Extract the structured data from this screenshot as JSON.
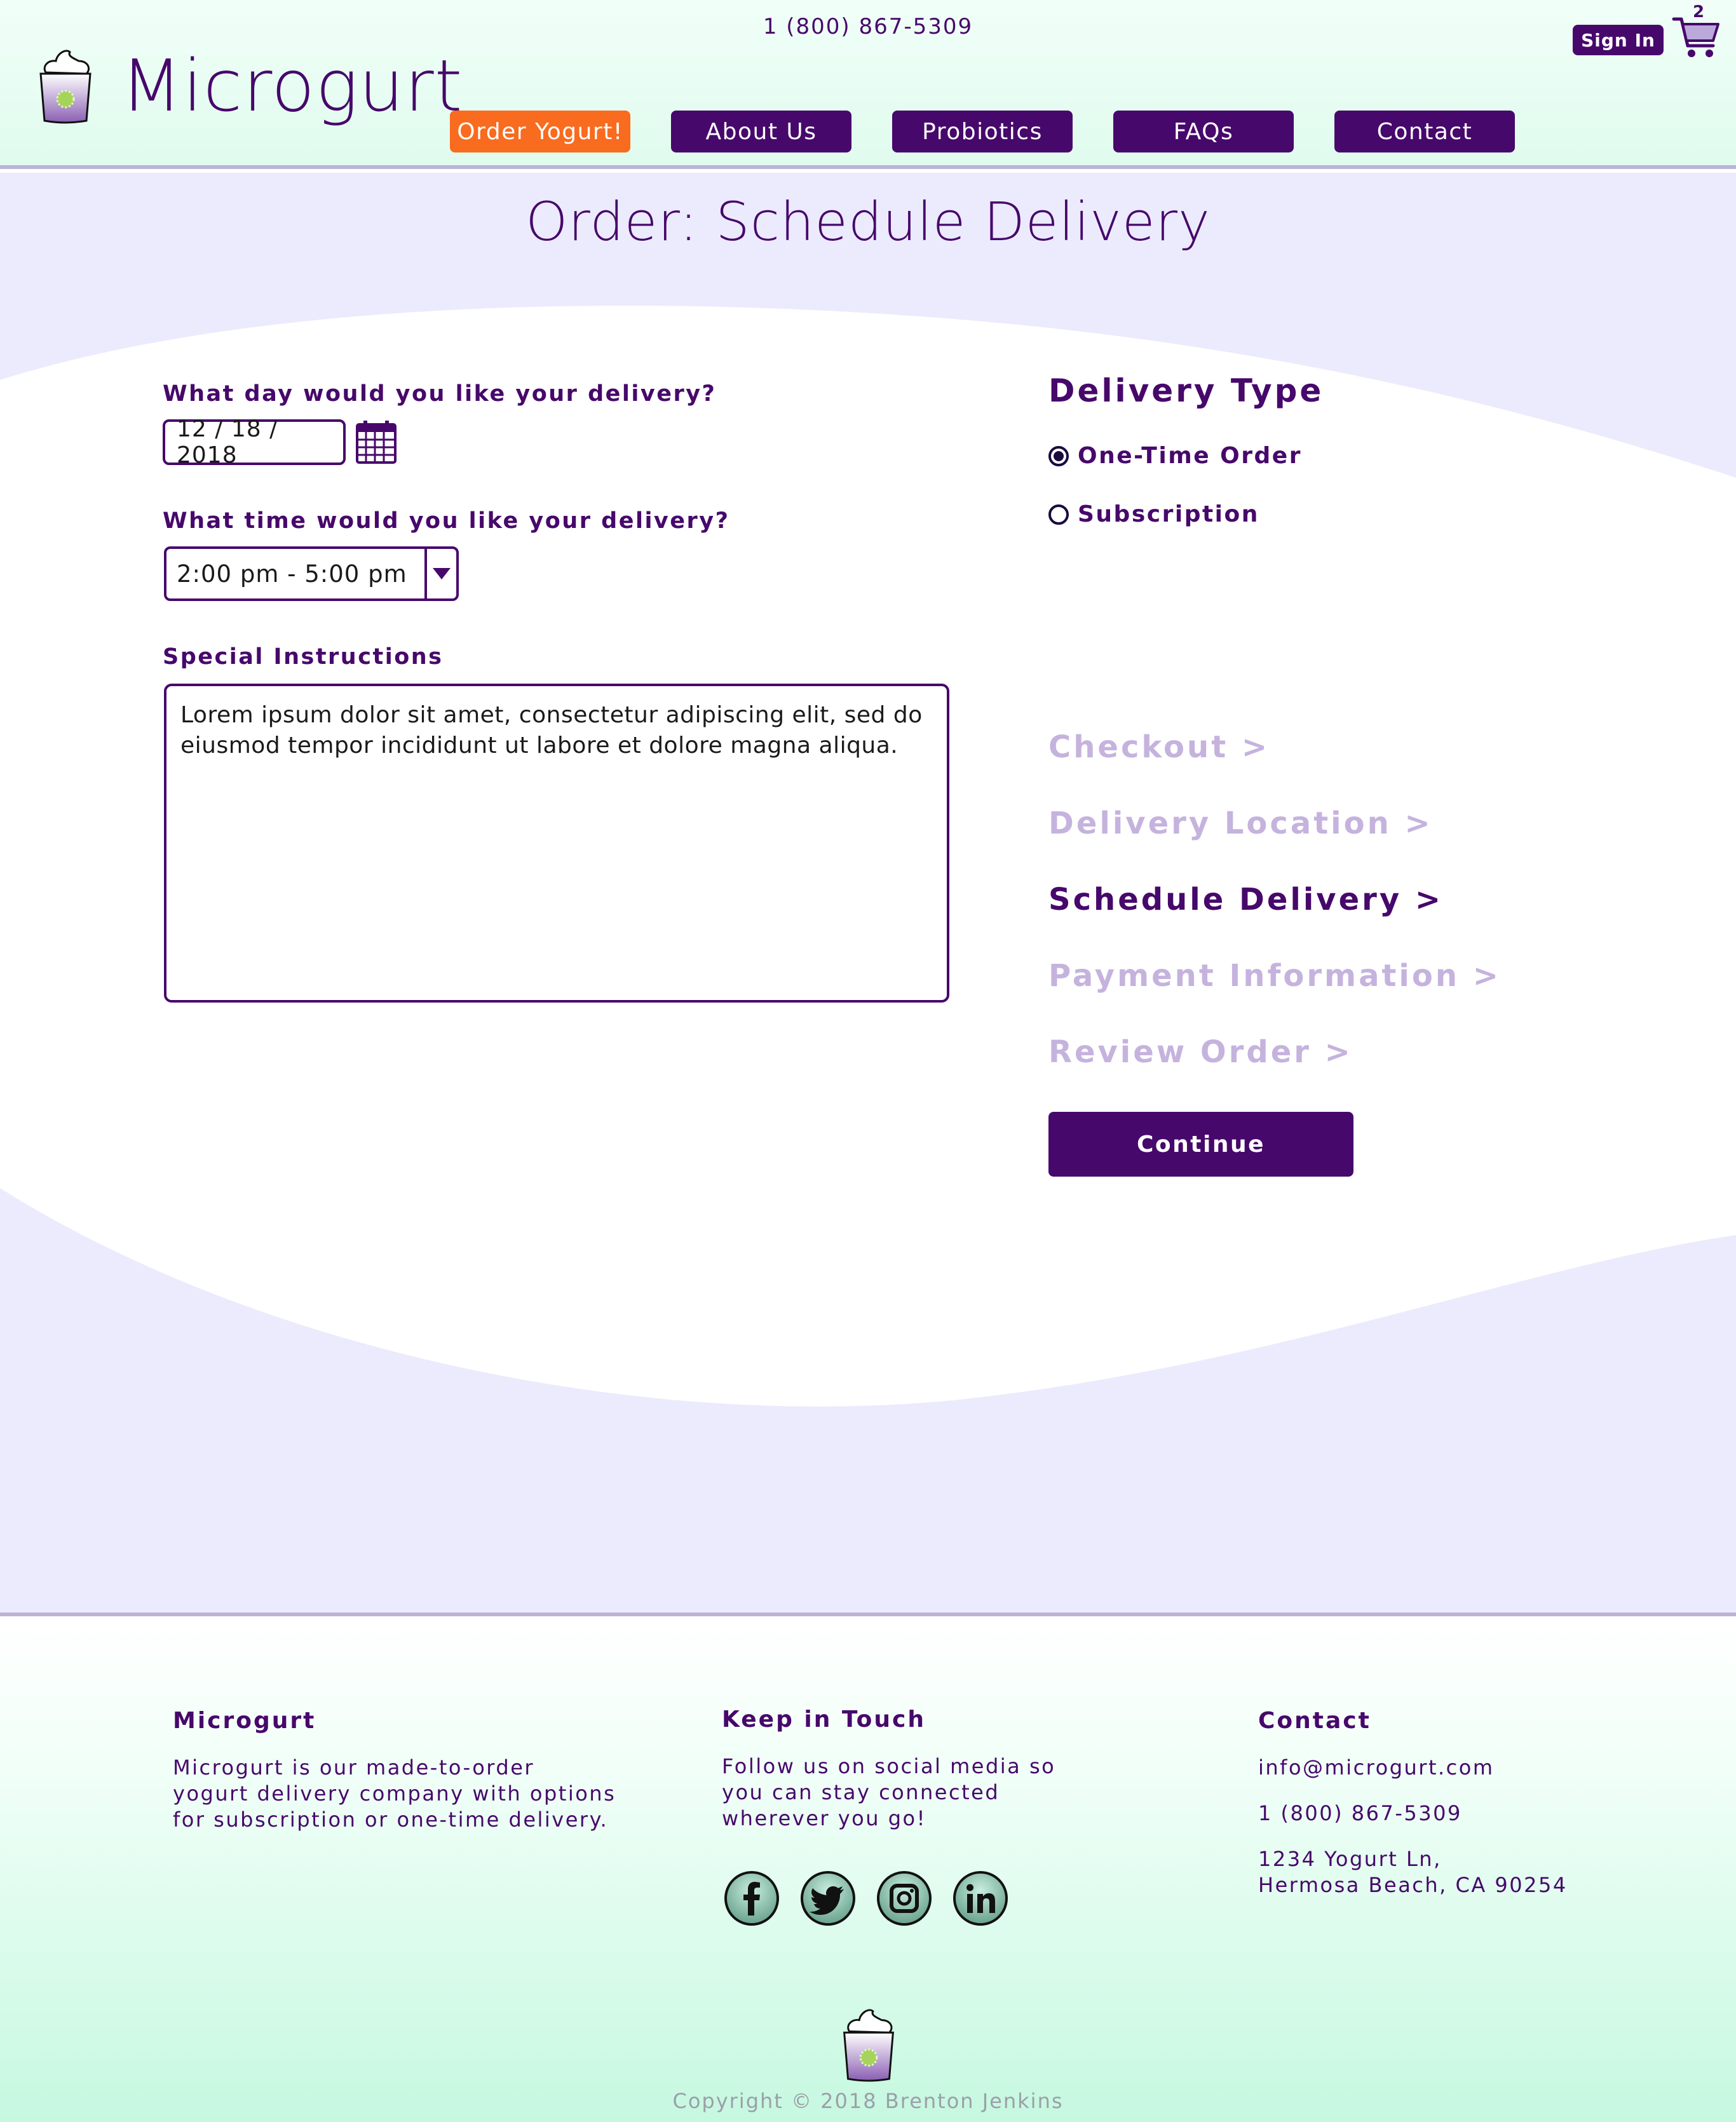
{
  "header": {
    "phone": "1 (800) 867-5309",
    "brand": "Microgurt",
    "nav": [
      {
        "label": "Order Yogurt!",
        "active": true
      },
      {
        "label": "About Us",
        "active": false
      },
      {
        "label": "Probiotics",
        "active": false
      },
      {
        "label": "FAQs",
        "active": false
      },
      {
        "label": "Contact",
        "active": false
      }
    ],
    "sign_in": "Sign In",
    "cart_count": "2"
  },
  "page": {
    "title": "Order: Schedule Delivery"
  },
  "form": {
    "date_label": "What day would you like your delivery?",
    "date_value": "12 / 18 / 2018",
    "time_label": "What time would you like your delivery?",
    "time_value": "2:00 pm - 5:00 pm",
    "instructions_label": "Special Instructions",
    "instructions_value": "Lorem ipsum dolor sit amet, consectetur adipiscing elit, sed do eiusmod tempor incididunt ut labore et dolore magna aliqua."
  },
  "delivery_type": {
    "title": "Delivery Type",
    "options": [
      {
        "label": "One-Time Order",
        "selected": true
      },
      {
        "label": "Subscription",
        "selected": false
      }
    ]
  },
  "steps": [
    {
      "label": "Checkout >",
      "current": false
    },
    {
      "label": "Delivery Location >",
      "current": false
    },
    {
      "label": "Schedule Delivery >",
      "current": true
    },
    {
      "label": "Payment Information >",
      "current": false
    },
    {
      "label": "Review Order >",
      "current": false
    }
  ],
  "continue_label": "Continue",
  "footer": {
    "about_title": "Microgurt",
    "about_text": "Microgurt is our made-to-order yogurt delivery company with options for subscription or one-time delivery.",
    "touch_title": "Keep in Touch",
    "touch_text": "Follow us on social media so you can stay connected wherever you go!",
    "social": [
      "facebook-icon",
      "twitter-icon",
      "instagram-icon",
      "linkedin-icon"
    ],
    "contact_title": "Contact",
    "email": "info@microgurt.com",
    "phone": "1 (800) 867-5309",
    "address_line1": "1234 Yogurt Ln,",
    "address_line2": "Hermosa Beach, CA 90254",
    "copyright": "Copyright © 2018 Brenton Jenkins"
  },
  "colors": {
    "brand_purple": "#47086b",
    "accent_orange": "#f96b1e",
    "inactive_step": "#c5b3de",
    "lavender_bg": "#ebebfd"
  }
}
